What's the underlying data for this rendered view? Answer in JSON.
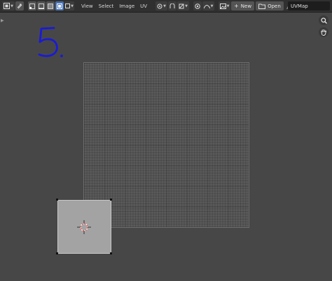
{
  "header": {
    "menus": [
      "View",
      "Select",
      "Image",
      "UV"
    ],
    "new_label": "New",
    "open_label": "Open",
    "uvmap_value": "UVMap"
  },
  "annotation": {
    "text": "5."
  },
  "colors": {
    "header_bg": "#303030",
    "viewport_bg": "#474747",
    "active_accent": "#4772b3",
    "annotation": "#1a1ad8",
    "uv_face": "#a3a3a3"
  },
  "icons": [
    "editor-type-icon",
    "sync-selection-icon",
    "vertex-select-icon",
    "edge-select-icon",
    "face-select-icon",
    "island-select-icon",
    "sticky-select-icon",
    "pivot-icon",
    "snap-icon",
    "snap-target-icon",
    "proportional-edit-icon",
    "falloff-icon",
    "image-browse-icon",
    "open-folder-icon",
    "pin-icon",
    "zoom-icon",
    "hand-icon"
  ]
}
